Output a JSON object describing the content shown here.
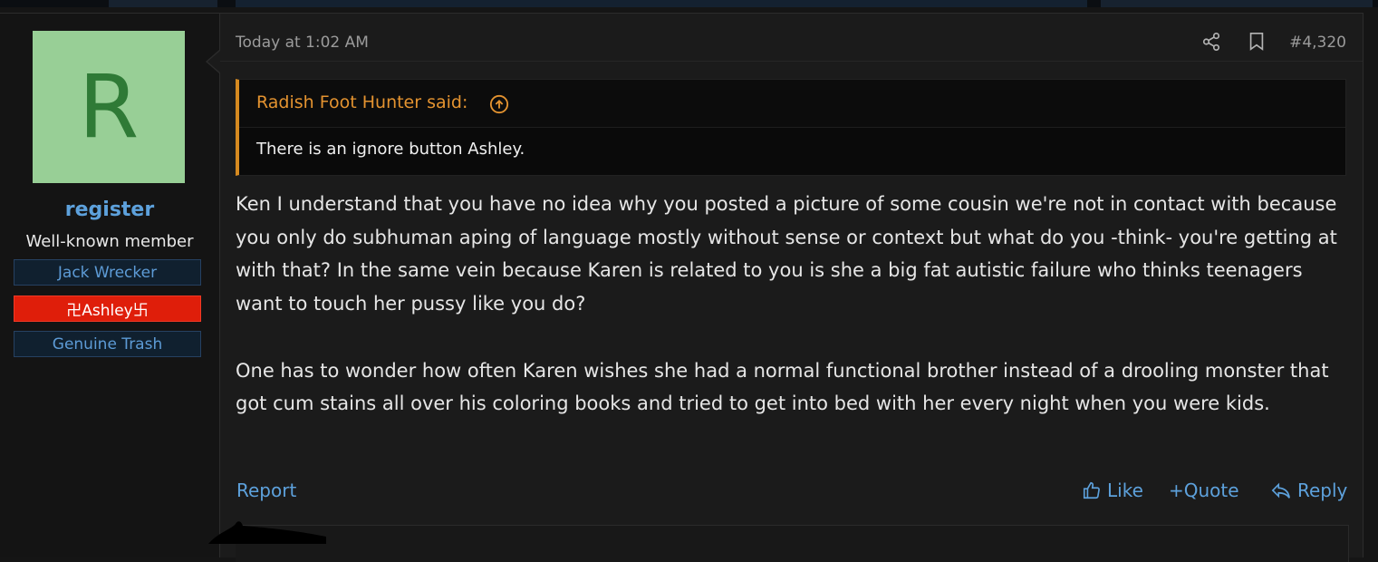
{
  "post": {
    "timestamp": "Today at 1:02 AM",
    "number": "#4,320",
    "user": {
      "avatar_letter": "R",
      "avatar_bg": "#98cf96",
      "avatar_fg": "#2f7a36",
      "name": "register",
      "title": "Well-known member",
      "banners": [
        "Jack Wrecker",
        "卍Ashley卐",
        "Genuine Trash"
      ]
    },
    "quote": {
      "author_label": "Radish Foot Hunter said:",
      "text": "There is an ignore button Ashley."
    },
    "body": [
      "Ken I understand that you have no idea why you posted a picture of some cousin we're not in contact with because you only do subhuman aping of language mostly without sense or context but what do you -think- you're getting at with that? In the same vein because Karen is related to you is she a big fat autistic failure who thinks teenagers want to touch her pussy like you do?",
      "One has to wonder how often Karen wishes she had a normal functional brother instead of a drooling monster that got cum stains all over his coloring books and tried to get into bed with her every night when you were kids."
    ],
    "actions": {
      "report": "Report",
      "like": "Like",
      "quote": "+Quote",
      "reply": "Reply"
    }
  },
  "colors": {
    "link": "#5da1dc",
    "quote_accent": "#d68a20",
    "banner_red": "#df1e0a"
  }
}
